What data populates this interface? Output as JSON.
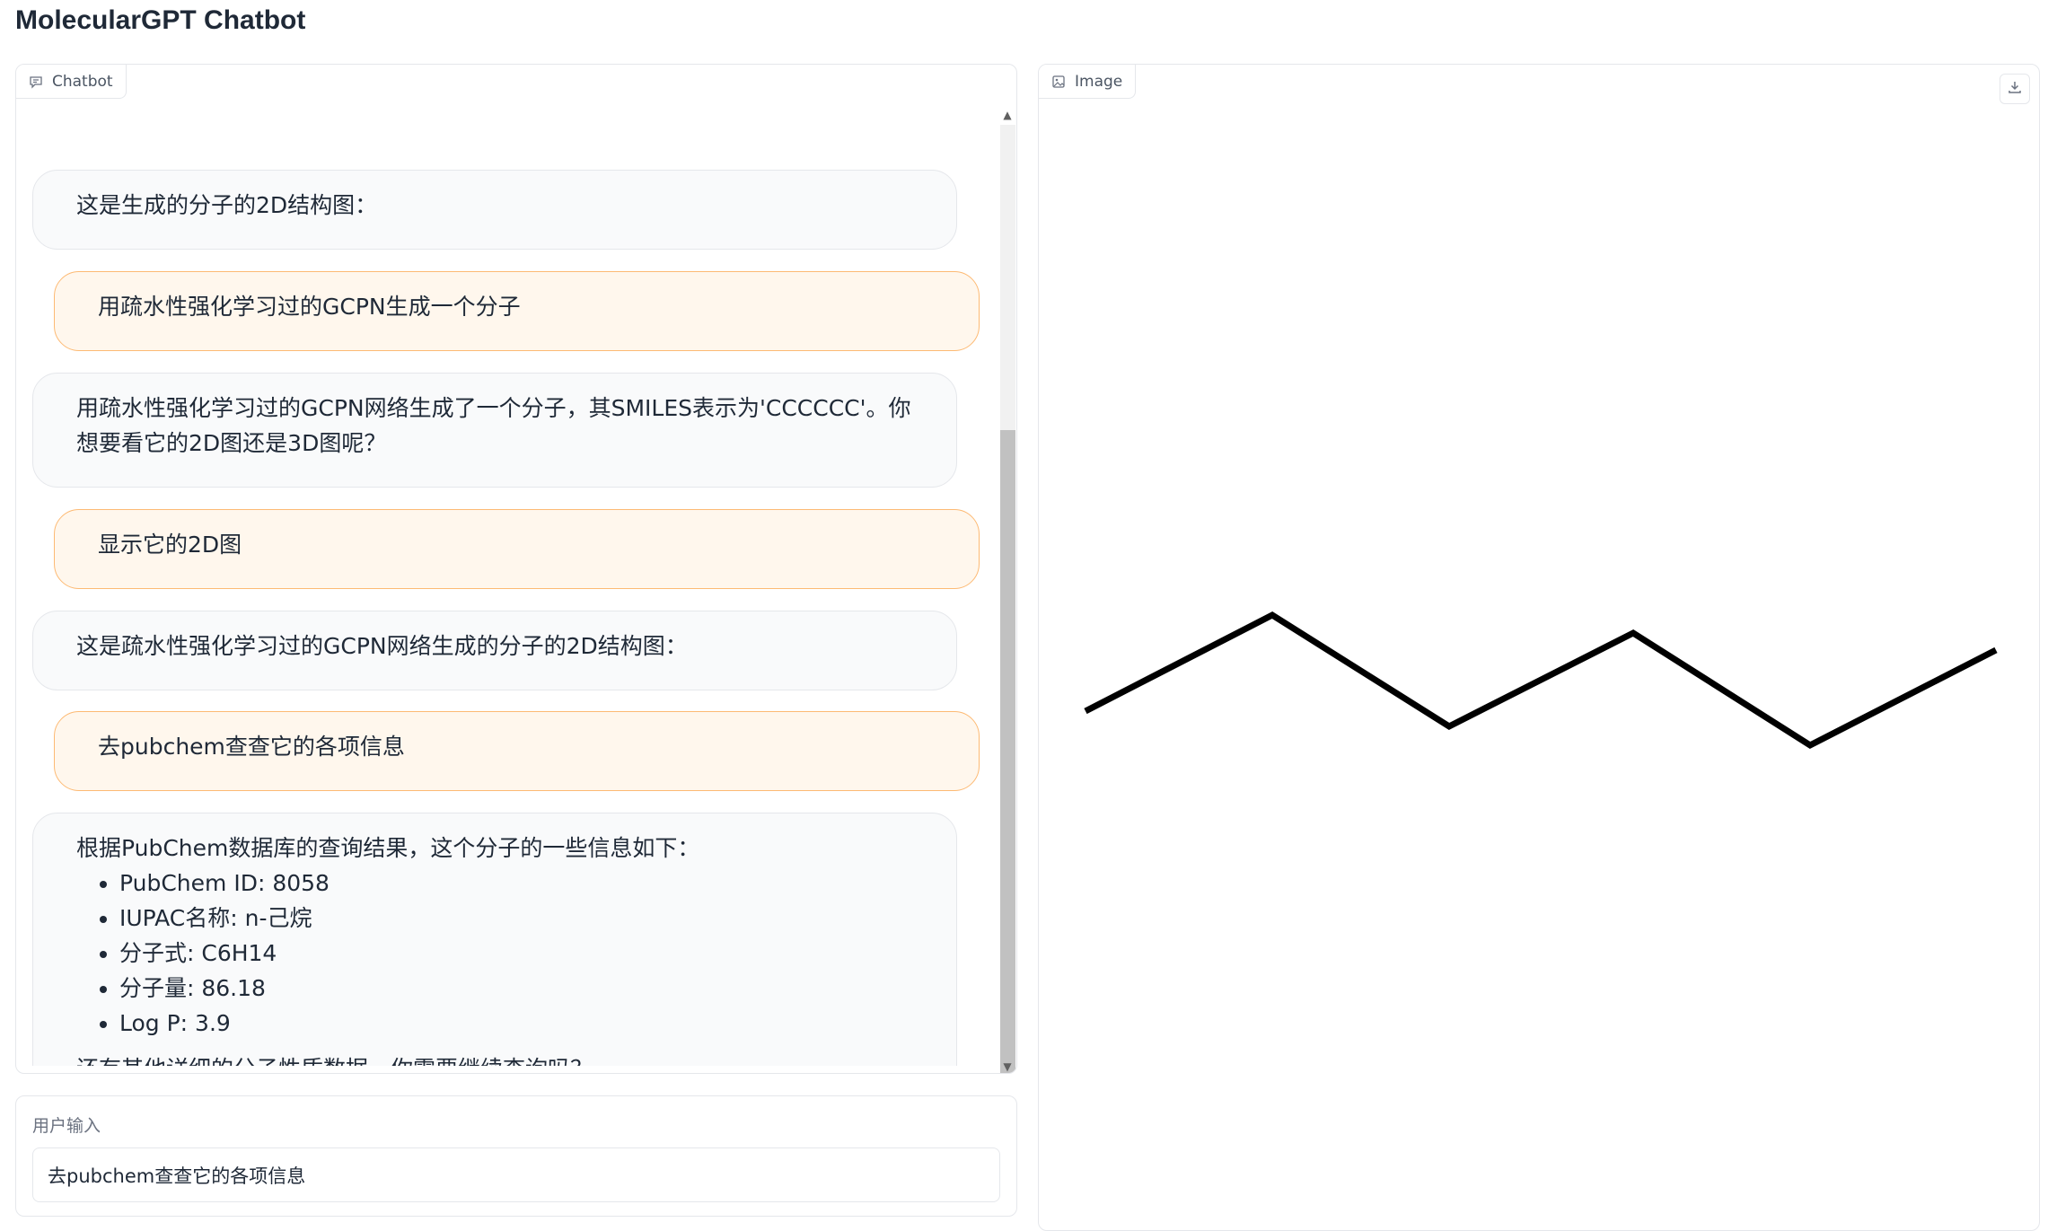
{
  "app": {
    "title": "MolecularGPT Chatbot"
  },
  "chatbot": {
    "label": "Chatbot",
    "messages": [
      {
        "role": "bot",
        "text": "这是生成的分子的2D结构图："
      },
      {
        "role": "user",
        "text": "用疏水性强化学习过的GCPN生成一个分子"
      },
      {
        "role": "bot",
        "text": "用疏水性强化学习过的GCPN网络生成了一个分子，其SMILES表示为'CCCCCC'。你想要看它的2D图还是3D图呢？"
      },
      {
        "role": "user",
        "text": "显示它的2D图"
      },
      {
        "role": "bot",
        "text": "这是疏水性强化学习过的GCPN网络生成的分子的2D结构图："
      },
      {
        "role": "user",
        "text": "去pubchem查查它的各项信息"
      },
      {
        "role": "bot",
        "intro": "根据PubChem数据库的查询结果，这个分子的一些信息如下：",
        "items": [
          "PubChem ID: 8058",
          "IUPAC名称: n-己烷",
          "分子式: C6H14",
          "分子量: 86.18",
          "Log P: 3.9"
        ],
        "closing": "还有其他详细的分子性质数据，你需要继续查询吗？"
      }
    ]
  },
  "image_panel": {
    "label": "Image",
    "download_icon": "download-icon",
    "molecule_smiles_shown": "CCCCCC"
  },
  "input": {
    "label": "用户输入",
    "value": "去pubchem查查它的各项信息"
  },
  "colors": {
    "user_bubble_bg": "#fff7ed",
    "user_bubble_border": "#fdba74",
    "bot_bubble_bg": "#f9fafb",
    "bond": "#000000"
  }
}
